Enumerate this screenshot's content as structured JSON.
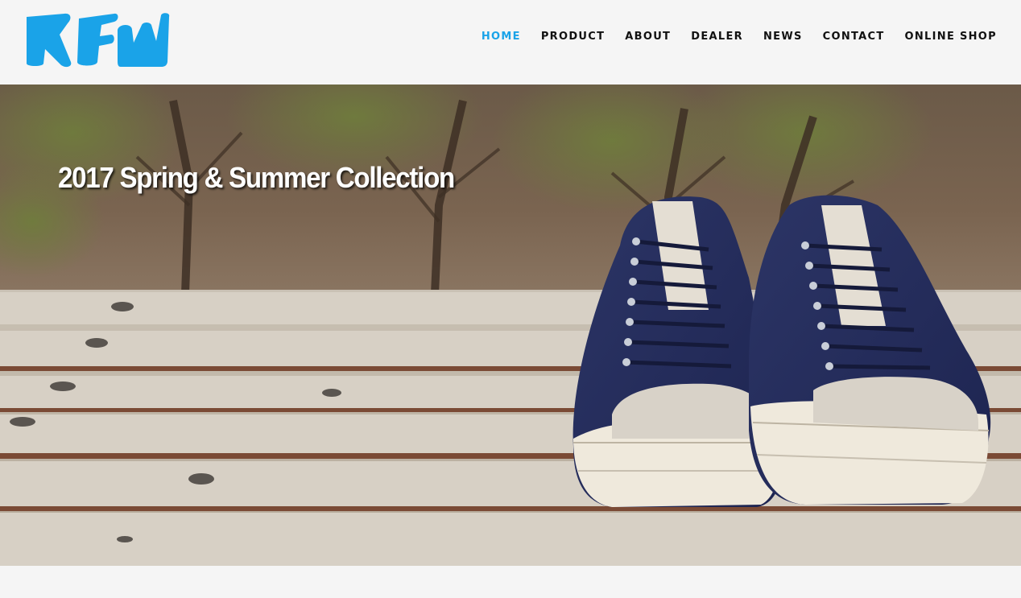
{
  "header": {
    "logo_alt": "RFW",
    "nav": [
      {
        "label": "HOME",
        "active": true
      },
      {
        "label": "PRODUCT",
        "active": false
      },
      {
        "label": "ABOUT",
        "active": false
      },
      {
        "label": "DEALER",
        "active": false
      },
      {
        "label": "NEWS",
        "active": false
      },
      {
        "label": "CONTACT",
        "active": false
      },
      {
        "label": "ONLINE SHOP",
        "active": false
      }
    ]
  },
  "hero": {
    "title": "2017 Spring & Summer Collection",
    "image_icon": "sneakers-on-bench-photo"
  },
  "colors": {
    "accent": "#1aa3e8",
    "nav_text": "#111111",
    "background": "#f5f5f5"
  }
}
